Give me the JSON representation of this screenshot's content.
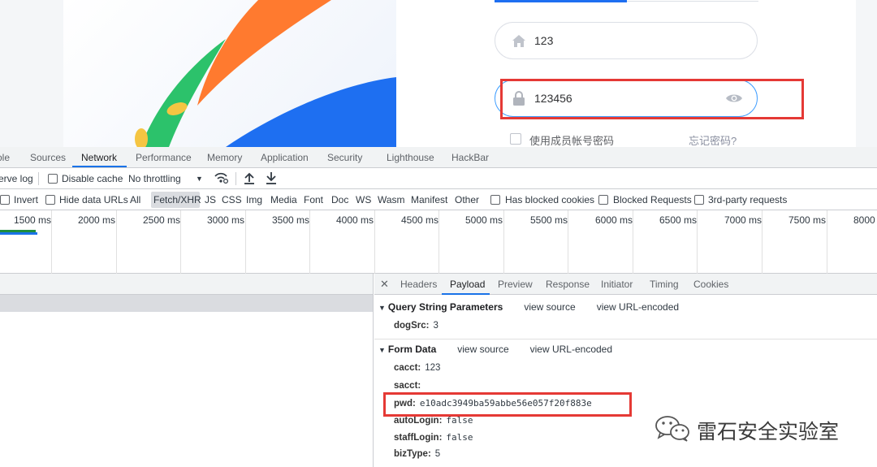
{
  "login": {
    "account_value": "123",
    "password_value": "123456",
    "member_label": "使用成员帐号密码",
    "forgot_label": "忘记密码?"
  },
  "devtools": {
    "tabs": [
      {
        "label": "ole"
      },
      {
        "label": "Sources"
      },
      {
        "label": "Network"
      },
      {
        "label": "Performance"
      },
      {
        "label": "Memory"
      },
      {
        "label": "Application"
      },
      {
        "label": "Security"
      },
      {
        "label": "Lighthouse"
      },
      {
        "label": "HackBar"
      }
    ],
    "toolbar": {
      "preserve_log": "erve log",
      "disable_cache": "Disable cache",
      "throttling": "No throttling"
    },
    "filters": {
      "invert": "Invert",
      "hide_data_urls": "Hide data URLs",
      "types": [
        "All",
        "Fetch/XHR",
        "JS",
        "CSS",
        "Img",
        "Media",
        "Font",
        "Doc",
        "WS",
        "Wasm",
        "Manifest",
        "Other"
      ],
      "blocked_cookies": "Has blocked cookies",
      "blocked_requests": "Blocked Requests",
      "third_party": "3rd-party requests"
    },
    "timeline_labels": [
      "1500 ms",
      "2000 ms",
      "2500 ms",
      "3000 ms",
      "3500 ms",
      "4000 ms",
      "4500 ms",
      "5000 ms",
      "5500 ms",
      "6000 ms",
      "6500 ms",
      "7000 ms",
      "7500 ms",
      "8000"
    ],
    "detail_tabs": [
      {
        "label": "Headers"
      },
      {
        "label": "Payload"
      },
      {
        "label": "Preview"
      },
      {
        "label": "Response"
      },
      {
        "label": "Initiator"
      },
      {
        "label": "Timing"
      },
      {
        "label": "Cookies"
      }
    ],
    "query_section": {
      "title": "Query String Parameters",
      "view_source": "view source",
      "view_url": "view URL-encoded",
      "params": [
        {
          "key": "dogSrc:",
          "value": "3"
        }
      ]
    },
    "form_section": {
      "title": "Form Data",
      "view_source": "view source",
      "view_url": "view URL-encoded",
      "params": [
        {
          "key": "cacct:",
          "value": "123"
        },
        {
          "key": "sacct:",
          "value": ""
        },
        {
          "key": "pwd:",
          "value": "e10adc3949ba59abbe56e057f20f883e"
        },
        {
          "key": "autoLogin:",
          "value": "false"
        },
        {
          "key": "staffLogin:",
          "value": "false"
        },
        {
          "key": "bizType:",
          "value": "5"
        }
      ]
    }
  },
  "watermark": {
    "text": "雷石安全实验室"
  },
  "colors": {
    "accent": "#1a73e8",
    "highlight": "#e53935",
    "brand_orange": "#ff7a2f",
    "brand_blue": "#1e6ff1",
    "brand_green": "#2cc26b"
  }
}
